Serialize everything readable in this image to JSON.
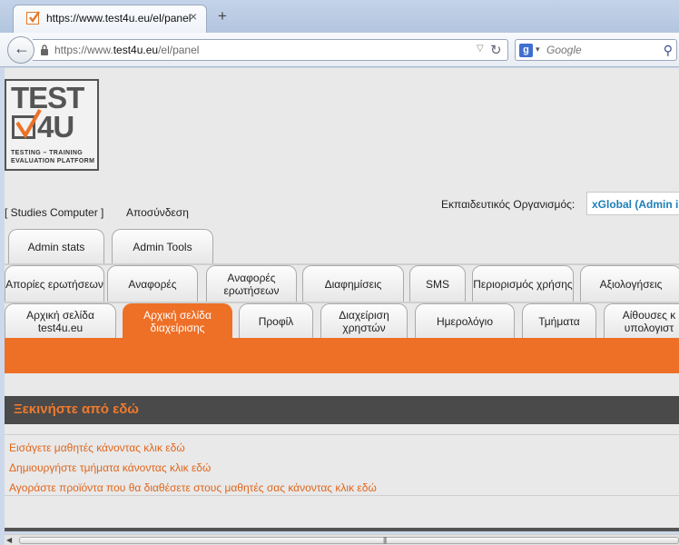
{
  "browser": {
    "tab_title": "https://www.test4u.eu/el/panel",
    "tab_close": "×",
    "new_tab": "+",
    "url_prefix": "https://www.",
    "url_domain": "test4u.eu",
    "url_path": "/el/panel",
    "search_placeholder": "Google"
  },
  "logo": {
    "word1": "TEST",
    "word2": "4U",
    "tagline1": "TESTING – TRAINING",
    "tagline2": "EVALUATION PLATFORM"
  },
  "header": {
    "user_line": "[ Studies Computer ]",
    "logout": "Αποσύνδεση",
    "org_label": "Εκπαιδευτικός Οργανισμός:",
    "org_value": "xGlobal (Admin i"
  },
  "tabs": {
    "row1": [
      "Admin stats",
      "Admin Tools"
    ],
    "row2": [
      "Απορίες ερωτήσεων",
      "Αναφορές",
      "Αναφορές ερωτήσεων",
      "Διαφημίσεις",
      "SMS",
      "Περιορισμός χρήσης",
      "Αξιολογήσεις"
    ],
    "row3": [
      "Αρχική σελίδα test4u.eu",
      "Αρχική σελίδα διαχείρισης",
      "Προφίλ",
      "Διαχείριση χρηστών",
      "Ημερολόγιο",
      "Τμήματα",
      "Αίθουσες κ υπολογιστ"
    ],
    "active_row3_index": 1
  },
  "section": {
    "title": "Ξεκινήστε από εδώ",
    "links": [
      "Εισάγετε μαθητές κάνοντας κλικ εδώ",
      "Δημιουργήστε τμήματα κάνοντας κλικ εδώ",
      "Αγοράστε προϊόντα που θα διαθέσετε στους μαθητές σας κάνοντας κλικ εδώ"
    ]
  },
  "colors": {
    "accent": "#ee7027",
    "header_bg": "#4a4a4a",
    "link": "#e0661d",
    "org_value": "#1d7fb8"
  },
  "icons": [
    "favicon-check-icon",
    "close-icon",
    "plus-icon",
    "back-arrow-icon",
    "lock-icon",
    "dropdown-icon",
    "reload-icon",
    "google-icon",
    "magnifier-icon"
  ]
}
